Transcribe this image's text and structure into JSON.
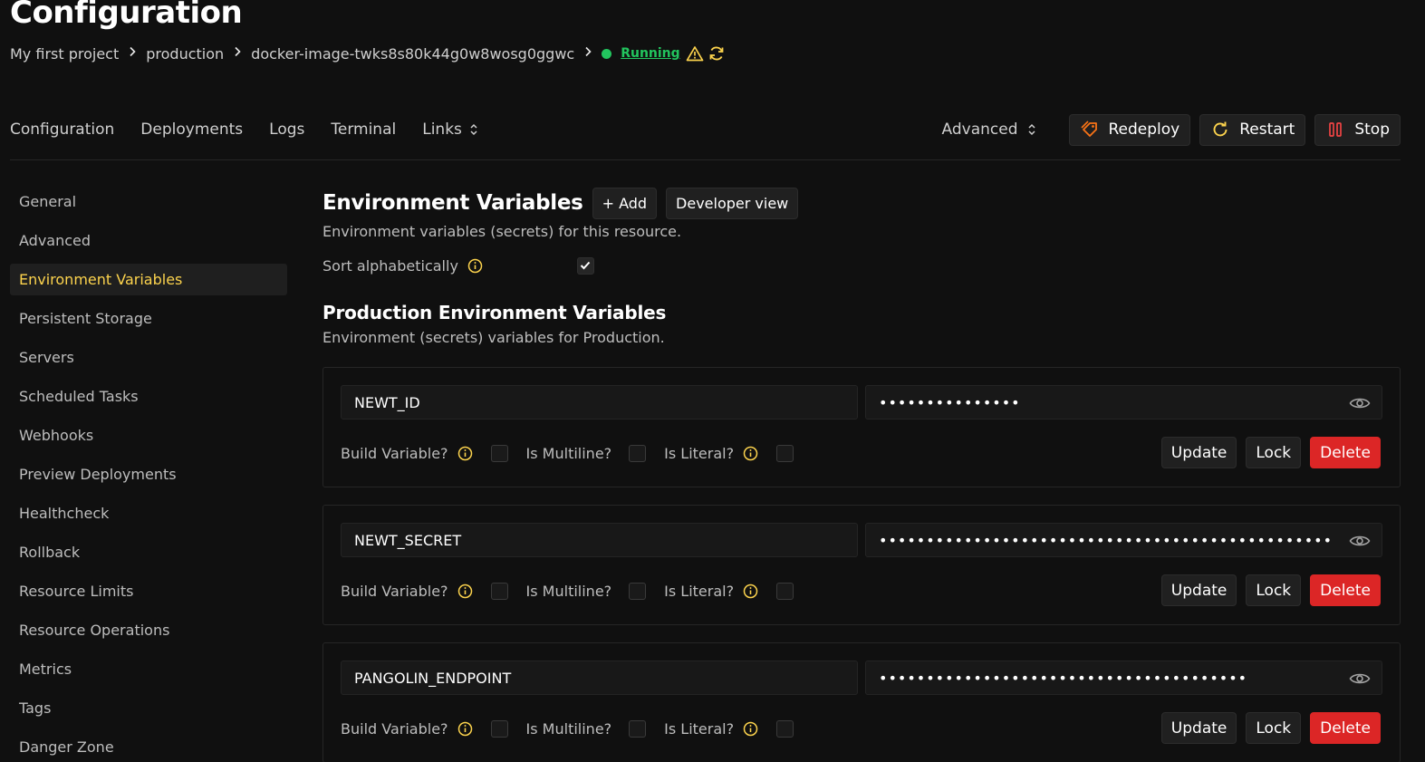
{
  "page": {
    "title": "Configuration"
  },
  "breadcrumb": {
    "project": "My first project",
    "environment": "production",
    "resource": "docker-image-twks8s80k44g0w8wosg0ggwc",
    "status": "Running",
    "status_color": "#22c55e",
    "icons": [
      "chevron-right-icon",
      "warning-icon",
      "reload-icon"
    ]
  },
  "nav": {
    "tabs": [
      "Configuration",
      "Deployments",
      "Logs",
      "Terminal",
      "Links"
    ],
    "advanced": "Advanced",
    "redeploy": "Redeploy",
    "restart": "Restart",
    "stop": "Stop"
  },
  "sidebar": {
    "active": "Environment Variables",
    "accent": "#fcd34d",
    "items": [
      "General",
      "Advanced",
      "Environment Variables",
      "Persistent Storage",
      "Servers",
      "Scheduled Tasks",
      "Webhooks",
      "Preview Deployments",
      "Healthcheck",
      "Rollback",
      "Resource Limits",
      "Resource Operations",
      "Metrics",
      "Tags",
      "Danger Zone"
    ]
  },
  "env": {
    "title": "Environment Variables",
    "add_label": "+ Add",
    "developer_view_label": "Developer view",
    "description": "Environment variables (secrets) for this resource.",
    "sort_label": "Sort alphabetically",
    "sort_checked": true
  },
  "production": {
    "title": "Production Environment Variables",
    "description": "Environment (secrets) variables for Production."
  },
  "labels": {
    "build_variable": "Build Variable?",
    "is_multiline": "Is Multiline?",
    "is_literal": "Is Literal?",
    "update": "Update",
    "lock": "Lock",
    "delete": "Delete"
  },
  "variables": [
    {
      "key": "NEWT_ID",
      "value_masked": "•••••••••••••••"
    },
    {
      "key": "NEWT_SECRET",
      "value_masked": "••••••••••••••••••••••••••••••••••••••••••••••••"
    },
    {
      "key": "PANGOLIN_ENDPOINT",
      "value_masked": "•••••••••••••••••••••••••••••••••••••••"
    }
  ],
  "colors": {
    "danger": "#dc2626",
    "info": "#fcd34d"
  }
}
